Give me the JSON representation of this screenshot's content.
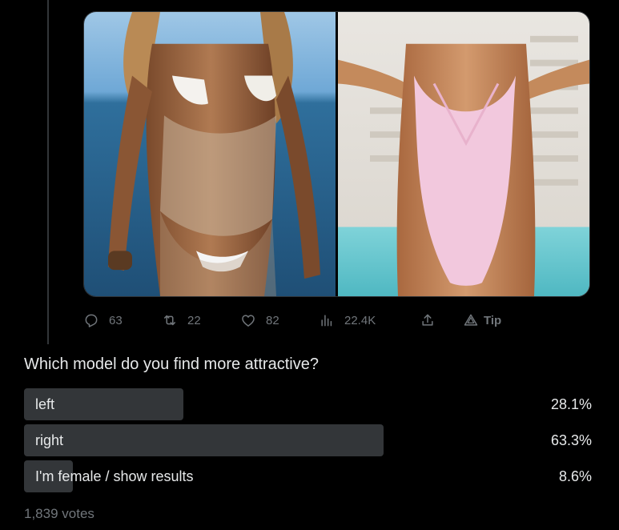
{
  "media": {
    "left_image": "photo-woman-bikini-sheer-wrap-ocean",
    "right_image": "photo-woman-pink-swimsuit-pool"
  },
  "actions": {
    "replies": "63",
    "reposts": "22",
    "likes": "82",
    "views": "22.4K",
    "tip_label": "Tip",
    "icons": [
      "reply-icon",
      "repost-icon",
      "like-icon",
      "views-icon",
      "share-icon",
      "tip-icon"
    ]
  },
  "poll": {
    "question": "Which model do you find more attractive?",
    "options": [
      {
        "label": "left",
        "percent_text": "28.1%",
        "percent": 28.1
      },
      {
        "label": "right",
        "percent_text": "63.3%",
        "percent": 63.3
      },
      {
        "label": "I'm female / show results",
        "percent_text": "8.6%",
        "percent": 8.6
      }
    ],
    "votes": "1,839 votes"
  },
  "colors": {
    "background": "#000000",
    "text": "#e7e9ea",
    "muted": "#71767b",
    "poll_bar": "#333639"
  }
}
